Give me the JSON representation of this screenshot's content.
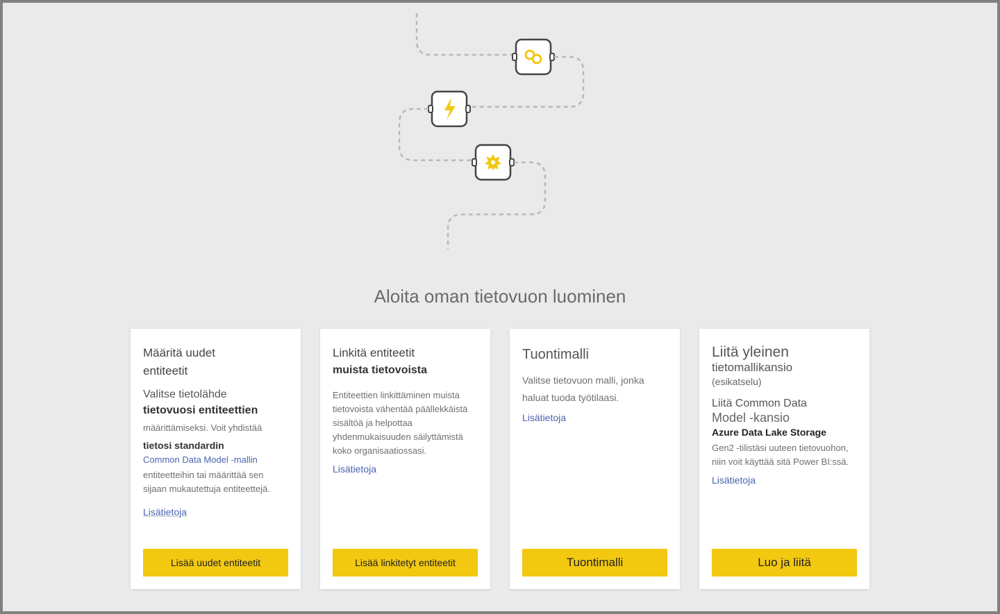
{
  "page": {
    "title": "Aloita oman tietovuon luominen"
  },
  "cards": [
    {
      "title_l1": "Määritä uudet",
      "title_l2": "entiteetit",
      "sub_l1": "Valitse tietolähde",
      "sub_l2": "tietovuosi entiteettien",
      "body_l1": "määrittämiseksi. Voit yhdistää",
      "body_l2": "tietosi standardin",
      "link_inline": "Common Data Model -mallin",
      "body_l3": "entiteetteihin tai määrittää sen sijaan mukautettuja entiteettejä.",
      "learn_more": "Lisätietoja",
      "cta": "Lisää uudet entiteetit"
    },
    {
      "title_l1": "Linkitä entiteetit",
      "title_l2": "muista tietovoista",
      "body": "Entiteettien linkittäminen muista tietovoista vähentää päällekkäistä sisältöä ja helpottaa yhdenmukaisuuden säilyttämistä koko organisaatiossasi.",
      "learn_more": "Lisätietoja",
      "cta": "Lisää linkitetyt entiteetit"
    },
    {
      "title_l1": "Tuontimalli",
      "body": "Valitse tietovuon malli, jonka haluat tuoda työtilaasi.",
      "learn_more": "Lisätietoja",
      "cta": "Tuontimalli"
    },
    {
      "title_l1": "Liitä yleinen",
      "title_l2": "tietomallikansio",
      "preview": "(esikatselu)",
      "sub_l1": "Liitä Common Data",
      "sub_l2": "Model -kansio",
      "sub_l3": "Azure Data Lake Storage",
      "body": "Gen2 -tilistäsi uuteen tietovuohon, niin voit käyttää sitä Power BI:ssä.",
      "learn_more": "Lisätietoja",
      "cta": "Luo ja liitä"
    }
  ],
  "icons": {
    "link": "link-icon",
    "bolt": "bolt-icon",
    "seal": "seal-icon"
  }
}
